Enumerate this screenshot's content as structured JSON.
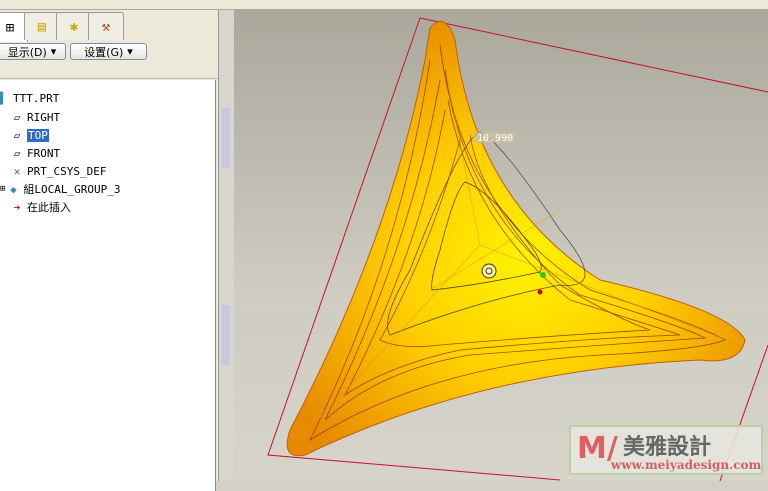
{
  "panel": {
    "show_label": "显示(D)",
    "settings_label": "设置(G)"
  },
  "tree": [
    {
      "label": "TTT.PRT",
      "icon": "part-icon"
    },
    {
      "label": "RIGHT",
      "icon": "datum-plane-icon"
    },
    {
      "label": "TOP",
      "icon": "datum-plane-icon",
      "selected": true
    },
    {
      "label": "FRONT",
      "icon": "datum-plane-icon"
    },
    {
      "label": "PRT_CSYS_DEF",
      "icon": "csys-icon"
    },
    {
      "label": "組LOCAL_GROUP_3",
      "icon": "group-icon"
    },
    {
      "label": "在此插入",
      "icon": "insert-arrow-icon"
    }
  ],
  "viewport": {
    "dimension": "10.990"
  },
  "watermark": {
    "brand": "美雅設計",
    "url": "www.meiyadesign.com"
  }
}
